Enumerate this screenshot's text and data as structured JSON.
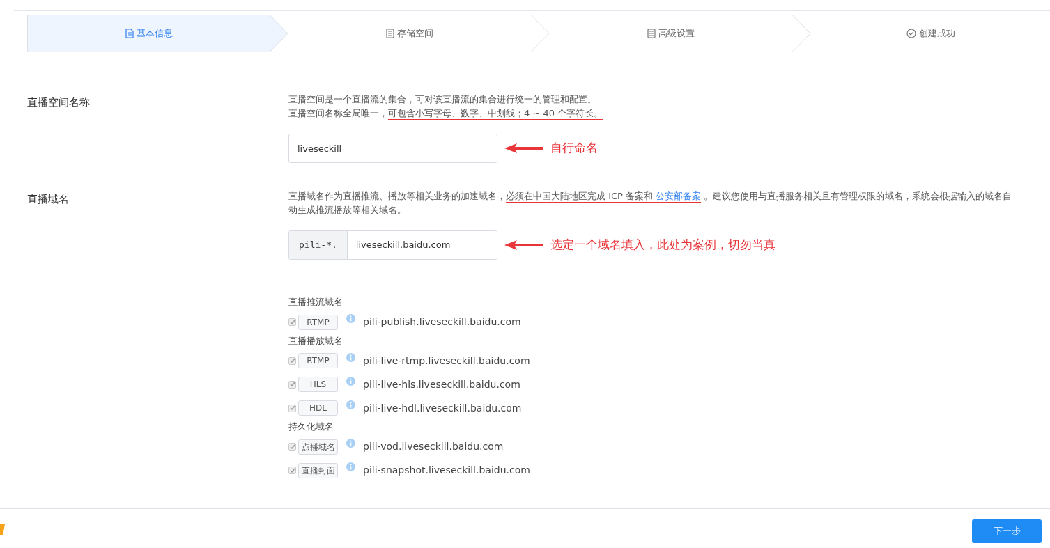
{
  "steps": [
    {
      "label": "基本信息",
      "kind": "document",
      "selected": true
    },
    {
      "label": "存储空间",
      "kind": "list",
      "selected": false
    },
    {
      "label": "高级设置",
      "kind": "list",
      "selected": false
    },
    {
      "label": "创建成功",
      "kind": "check",
      "selected": false
    }
  ],
  "sections": [
    {
      "label": "直播空间名称",
      "description": [
        [
          {
            "text": "直播空间是一个直播流的集合，可对该直播流的集合进行统一的管理和配置。",
            "kind": "text",
            "underlined": false
          }
        ],
        [
          {
            "text": "直播空间名称全局唯一，",
            "kind": "text",
            "underlined": false
          },
          {
            "text": "可包含小写字母、数字、中划线；4 ~ 40 个字符长。",
            "kind": "text",
            "underlined": true
          }
        ]
      ],
      "field": {
        "value": "liveseckill"
      },
      "annotation": "自行命名"
    },
    {
      "label": "直播域名",
      "description": [
        [
          {
            "text": "直播域名作为直播推流、播放等相关业务的加速域名，",
            "kind": "text",
            "underlined": false
          },
          {
            "text": "必须在中国大陆地区完成 ICP 备案和 ",
            "kind": "text",
            "underlined": true
          },
          {
            "text": "公安部备案",
            "kind": "link",
            "underlined": true
          },
          {
            "text": " 。建议您使用与直播服务相关且有管理权限的域名，系统会根据输入的域名自动生成推流播放等相关域名。",
            "kind": "text",
            "underlined": false
          }
        ]
      ],
      "field": {
        "prefix": "pili-*.",
        "value": "liveseckill.baidu.com"
      },
      "annotation": "选定一个域名填入，此处为案例，切勿当真",
      "groups": [
        {
          "title": "直播推流域名",
          "items": [
            {
              "tag": "RTMP",
              "domain": "pili-publish.liveseckill.baidu.com",
              "checked": true
            }
          ]
        },
        {
          "title": "直播播放域名",
          "items": [
            {
              "tag": "RTMP",
              "domain": "pili-live-rtmp.liveseckill.baidu.com",
              "checked": true
            },
            {
              "tag": "HLS",
              "domain": "pili-live-hls.liveseckill.baidu.com",
              "checked": true
            },
            {
              "tag": "HDL",
              "domain": "pili-live-hdl.liveseckill.baidu.com",
              "checked": true
            }
          ]
        },
        {
          "title": "持久化域名",
          "items": [
            {
              "tag": "点播域名",
              "domain": "pili-vod.liveseckill.baidu.com",
              "checked": true
            },
            {
              "tag": "直播封面",
              "domain": "pili-snapshot.liveseckill.baidu.com",
              "checked": true
            }
          ]
        }
      ]
    }
  ],
  "footer": {
    "button": "下一步"
  }
}
